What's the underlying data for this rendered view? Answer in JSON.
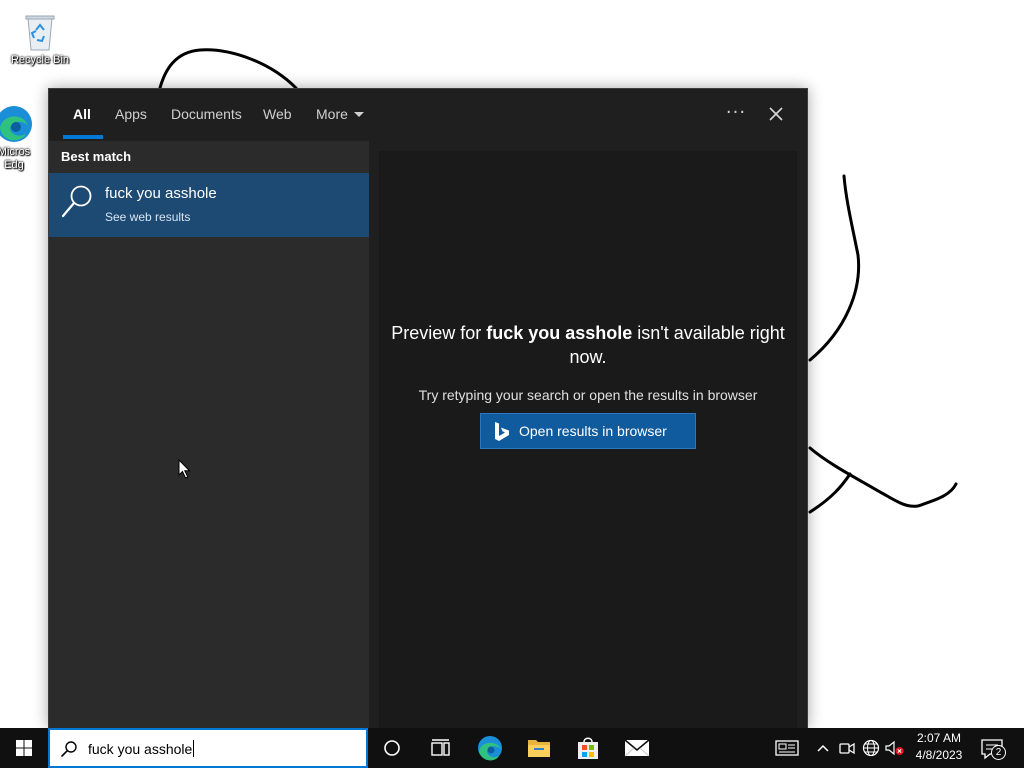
{
  "desktop": {
    "icons": [
      {
        "label": "Recycle Bin"
      },
      {
        "label": "Microsoft Edge",
        "visible_label_line1": "Micros",
        "visible_label_line2": "Edg"
      }
    ]
  },
  "search_panel": {
    "tabs": [
      {
        "label": "All",
        "active": true
      },
      {
        "label": "Apps"
      },
      {
        "label": "Documents"
      },
      {
        "label": "Web"
      },
      {
        "label": "More"
      }
    ],
    "options_label": "···",
    "best_match_heading": "Best match",
    "best_match": {
      "title": "fuck you asshole",
      "subtitle": "See web results"
    },
    "preview": {
      "msg_prefix": "Preview for ",
      "query": "fuck you asshole",
      "msg_suffix": " isn't available right now.",
      "hint": "Try retyping your search or open the results in browser",
      "open_button": "Open results in browser"
    }
  },
  "taskbar": {
    "search_value": "fuck you asshole",
    "clock_time": "2:07 AM",
    "clock_date": "4/8/2023",
    "notification_count": "2"
  },
  "colors": {
    "accent": "#0078d4",
    "result_highlight": "#1d4a73",
    "panel_bg": "#2b2b2b",
    "topbar_bg": "#1f1f1f",
    "taskbar_bg": "#101010"
  }
}
